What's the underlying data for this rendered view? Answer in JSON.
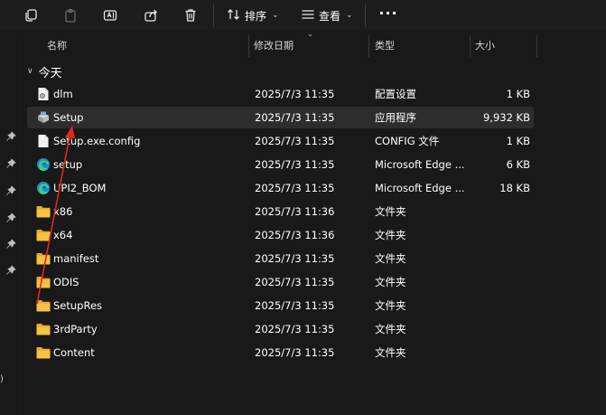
{
  "toolbar": {
    "sort_label": "排序",
    "view_label": "查看",
    "more_label": "···"
  },
  "columns": {
    "name": "名称",
    "date": "修改日期",
    "type": "类型",
    "size": "大小"
  },
  "group": {
    "label": "今天"
  },
  "left_strip": {
    "mark": ")"
  },
  "files": [
    {
      "name": "dlm",
      "date": "2025/7/3 11:35",
      "type": "配置设置",
      "size": "1 KB",
      "icon": "config-file-icon"
    },
    {
      "name": "Setup",
      "date": "2025/7/3 11:35",
      "type": "应用程序",
      "size": "9,932 KB",
      "icon": "setup-app-icon",
      "selected": true
    },
    {
      "name": "Setup.exe.config",
      "date": "2025/7/3 11:35",
      "type": "CONFIG 文件",
      "size": "1 KB",
      "icon": "blank-file-icon"
    },
    {
      "name": "setup",
      "date": "2025/7/3 11:35",
      "type": "Microsoft Edge ...",
      "size": "6 KB",
      "icon": "edge-icon"
    },
    {
      "name": "UPI2_BOM",
      "date": "2025/7/3 11:35",
      "type": "Microsoft Edge ...",
      "size": "18 KB",
      "icon": "edge-icon"
    },
    {
      "name": "x86",
      "date": "2025/7/3 11:36",
      "type": "文件夹",
      "size": "",
      "icon": "folder-icon"
    },
    {
      "name": "x64",
      "date": "2025/7/3 11:36",
      "type": "文件夹",
      "size": "",
      "icon": "folder-icon"
    },
    {
      "name": "manifest",
      "date": "2025/7/3 11:35",
      "type": "文件夹",
      "size": "",
      "icon": "folder-icon"
    },
    {
      "name": "ODIS",
      "date": "2025/7/3 11:35",
      "type": "文件夹",
      "size": "",
      "icon": "folder-icon"
    },
    {
      "name": "SetupRes",
      "date": "2025/7/3 11:35",
      "type": "文件夹",
      "size": "",
      "icon": "folder-icon"
    },
    {
      "name": "3rdParty",
      "date": "2025/7/3 11:35",
      "type": "文件夹",
      "size": "",
      "icon": "folder-icon"
    },
    {
      "name": "Content",
      "date": "2025/7/3 11:35",
      "type": "文件夹",
      "size": "",
      "icon": "folder-icon"
    }
  ],
  "colors": {
    "background": "#191919",
    "selected_row": "#2d2d2d",
    "folder": "#f5c244",
    "annotation_arrow": "#e0281e"
  }
}
